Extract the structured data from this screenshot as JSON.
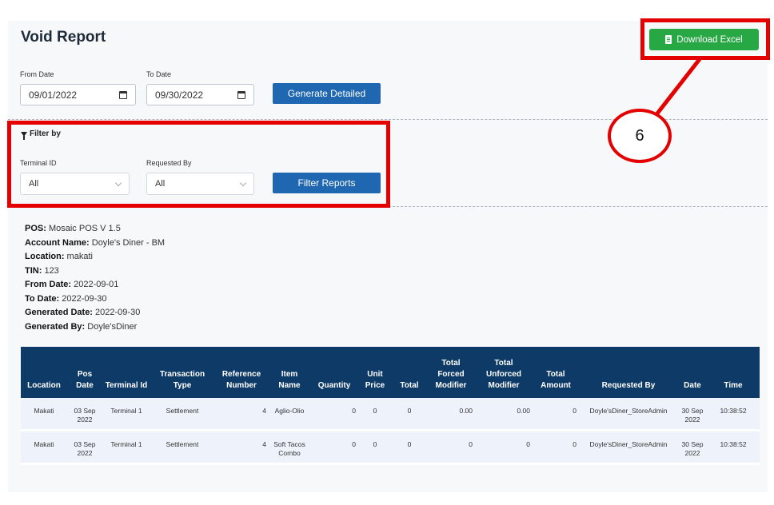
{
  "page": {
    "title": "Void Report",
    "download_label": "Download Excel"
  },
  "annotation": {
    "number": "6"
  },
  "dates": {
    "from_label": "From Date",
    "from_value": "09/01/2022",
    "to_label": "To Date",
    "to_value": "09/30/2022",
    "generate_label": "Generate Detailed"
  },
  "filter": {
    "heading": "Filter by",
    "terminal_label": "Terminal ID",
    "terminal_value": "All",
    "requested_label": "Requested By",
    "requested_value": "All",
    "button_label": "Filter Reports"
  },
  "info": [
    {
      "key": "POS:",
      "value": " Mosaic POS V 1.5"
    },
    {
      "key": "Account Name:",
      "value": " Doyle's Diner - BM"
    },
    {
      "key": "Location:",
      "value": " makati"
    },
    {
      "key": "TIN:",
      "value": " 123"
    },
    {
      "key": "From Date:",
      "value": " 2022-09-01"
    },
    {
      "key": "To Date:",
      "value": " 2022-09-30"
    },
    {
      "key": "Generated Date:",
      "value": " 2022-09-30"
    },
    {
      "key": "Generated By:",
      "value": " Doyle'sDiner"
    }
  ],
  "table": {
    "headers": [
      "Location",
      "Pos Date",
      "Terminal Id",
      "Transaction Type",
      "Reference Number",
      "Item Name",
      "Quantity",
      "Unit Price",
      "Total",
      "Total Forced Modifier",
      "Total Unforced Modifier",
      "Total Amount",
      "Requested By",
      "Date",
      "Time"
    ],
    "rows": [
      [
        "Makati",
        "03 Sep 2022",
        "Terminal 1",
        "Settlement",
        "4",
        "Aglio-Olio",
        "0",
        "0",
        "0",
        "0.00",
        "0.00",
        "0",
        "Doyle'sDiner_StoreAdmin",
        "30 Sep 2022",
        "10:38:52"
      ],
      [
        "Makati",
        "03 Sep 2022",
        "Terminal 1",
        "Settlement",
        "4",
        "Soft Tacos Combo",
        "0",
        "0",
        "0",
        "0",
        "0",
        "0",
        "Doyle'sDiner_StoreAdmin",
        "30 Sep 2022",
        "10:38:52"
      ]
    ]
  }
}
